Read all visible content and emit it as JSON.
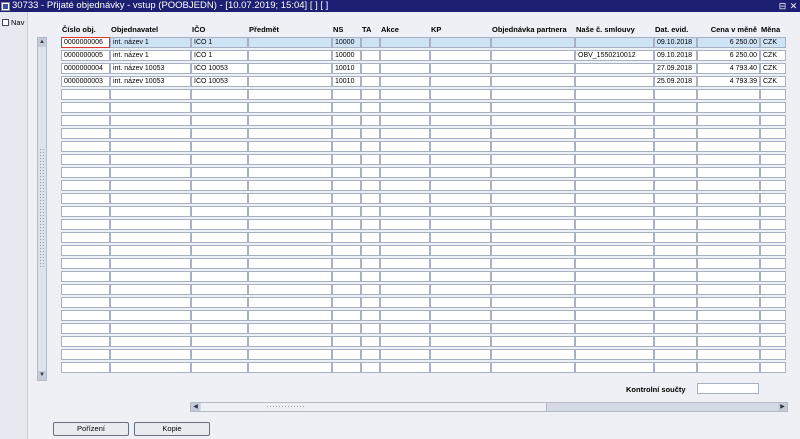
{
  "window": {
    "title": "30733 - Přijaté objednávky - vstup (POOBJEDN) - [10.07.2019; 15:04]  [ ]  [ ]",
    "controls": [
      "⊟",
      "✕"
    ]
  },
  "nav": {
    "label": "Nav"
  },
  "columns": [
    {
      "label": "Číslo obj."
    },
    {
      "label": "Objednavatel"
    },
    {
      "label": "IČO"
    },
    {
      "label": "Předmět"
    },
    {
      "label": "NS"
    },
    {
      "label": "TA"
    },
    {
      "label": "Akce"
    },
    {
      "label": "KP"
    },
    {
      "label": "Objednávka partnera"
    },
    {
      "label": "Naše č. smlouvy"
    },
    {
      "label": "Dat. evid."
    },
    {
      "label": "Cena v měně"
    },
    {
      "label": "Měna"
    }
  ],
  "rows": [
    [
      "0000000006",
      "int. název 1",
      "IČO 1",
      "",
      "10000",
      "",
      "",
      "",
      "",
      "",
      "09.10.2018",
      "6 250.00",
      "CZK"
    ],
    [
      "0000000005",
      "int. název 1",
      "IČO 1",
      "",
      "10000",
      "",
      "",
      "",
      "",
      "OBV_1550210012",
      "09.10.2018",
      "6 250.00",
      "CZK"
    ],
    [
      "0000000004",
      "int. název 10053",
      "IČO 10053",
      "",
      "10010",
      "",
      "",
      "",
      "",
      "",
      "27.09.2018",
      "4 793.40",
      "CZK"
    ],
    [
      "0000000003",
      "int. název 10053",
      "IČO 10053",
      "",
      "10010",
      "",
      "",
      "",
      "",
      "",
      "25.09.2018",
      "4 793.39",
      "CZK"
    ]
  ],
  "empty_row_count": 22,
  "footer": {
    "kontrolni_label": "Kontrolní součty",
    "kontrolni_value": ""
  },
  "buttons": {
    "porizeni": "Pořízení",
    "kopie": "Kopie"
  },
  "icons": {
    "vscroll_up": "▲",
    "vscroll_down": "▼",
    "hscroll_left": "◀",
    "hscroll_right": "▶"
  },
  "colors": {
    "titlebar": "#1d1f73",
    "selected_row": "#cfe3f7",
    "focus_border": "#dd3333"
  }
}
